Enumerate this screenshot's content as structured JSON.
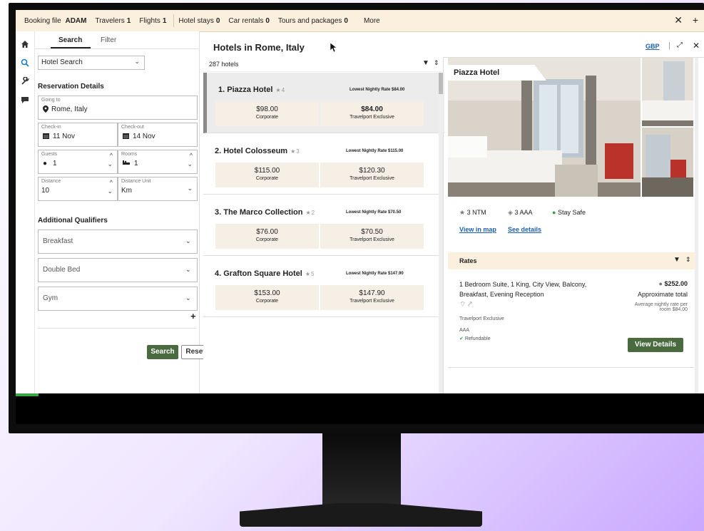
{
  "topbar": {
    "booking_label": "Booking file",
    "booking_value": "ADAM",
    "tabs": [
      {
        "label": "Travelers",
        "count": "1"
      },
      {
        "label": "Flights",
        "count": "1"
      },
      {
        "label": "Hotel stays",
        "count": "0"
      },
      {
        "label": "Car rentals",
        "count": "0"
      },
      {
        "label": "Tours and packages",
        "count": "0"
      }
    ],
    "more": "More",
    "close": "✕",
    "add": "+"
  },
  "search_panel": {
    "tab_search": "Search",
    "tab_filter": "Filter",
    "search_type": "Hotel Search",
    "reservation_title": "Reservation Details",
    "going_to_label": "Going to",
    "going_to_value": "Rome, Italy",
    "checkin_label": "Check-in",
    "checkin_value": "11 Nov",
    "checkout_label": "Check-out",
    "checkout_value": "14 Nov",
    "guests_label": "Guests",
    "guests_value": "1",
    "rooms_label": "Rooms",
    "rooms_value": "1",
    "distance_label": "Distance",
    "distance_value": "10",
    "distance_unit_label": "Distance Unit",
    "distance_unit_value": "Km",
    "qualifiers_title": "Additional Qualifiers",
    "qualifiers": [
      "Breakfast",
      "Double Bed",
      "Gym"
    ],
    "add": "+",
    "search_button": "Search",
    "reset_button": "Reset"
  },
  "results": {
    "title": "Hotels in Rome, Italy",
    "count": "287 hotels",
    "currency": "GBP",
    "hotels": [
      {
        "name": "1. Piazza Hotel",
        "stars": "4",
        "lowest": "Lowest Nightly Rate $84.00",
        "price1": "$98.00",
        "label1": "Corporate",
        "price2": "$84.00",
        "label2": "Travelport Exclusive"
      },
      {
        "name": "2. Hotel Colosseum",
        "stars": "3",
        "lowest": "Lowest Nightly Rate $115.00",
        "price1": "$115.00",
        "label1": "Corporate",
        "price2": "$120.30",
        "label2": "Travelport Exclusive"
      },
      {
        "name": "3. The Marco Collection",
        "stars": "2",
        "lowest": "Lowest Nightly Rate $70.50",
        "price1": "$76.00",
        "label1": "Corporate",
        "price2": "$70.50",
        "label2": "Travelport Exclusive"
      },
      {
        "name": "4. Grafton Square Hotel",
        "stars": "5",
        "lowest": "Lowest Nightly Rate $147.90",
        "price1": "$153.00",
        "label1": "Corporate",
        "price2": "$147.90",
        "label2": "Travelport Exclusive"
      }
    ]
  },
  "detail": {
    "hotel_name": "Piazza Hotel",
    "ntm": "3 NTM",
    "aaa": "3 AAA",
    "stay_safe": "Stay Safe",
    "view_map": "View in map",
    "see_details": "See details",
    "rates_title": "Rates",
    "rate_desc": "1 Bedroom Suite, 1 King, City View, Balcony, Breakfast, Evening Reception",
    "rate_price": "$252.00",
    "rate_approx": "Approximate total",
    "rate_avg": "Average nightly rate per room $84.00",
    "rate_type": "Travelport Exclusive",
    "rate_aaa": "AAA",
    "refundable": "Refundable",
    "view_details": "View Details"
  }
}
